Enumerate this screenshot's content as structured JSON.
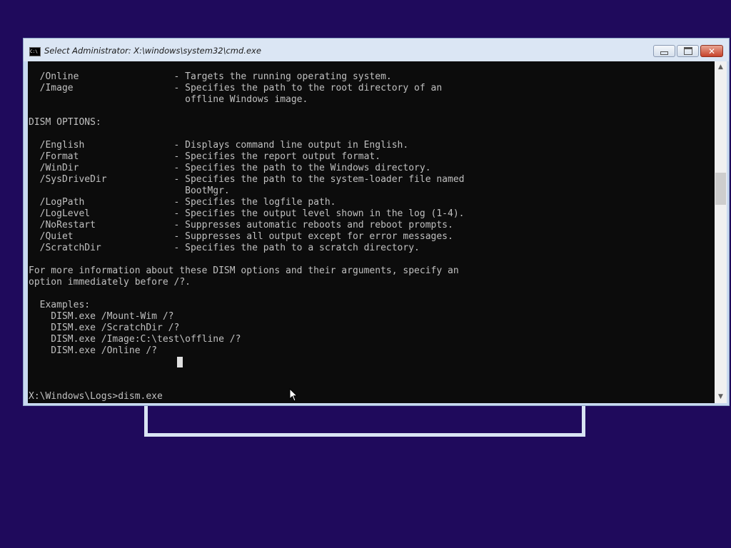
{
  "window": {
    "title": "Select Administrator: X:\\windows\\system32\\cmd.exe",
    "icon": "cmd-icon",
    "icon_text": "C:\\",
    "minimize_glyph": "",
    "maximize_glyph": "",
    "close_glyph": "✕"
  },
  "console": {
    "lines": [
      "  /Online                 - Targets the running operating system.",
      "  /Image                  - Specifies the path to the root directory of an",
      "                            offline Windows image.",
      "",
      "DISM OPTIONS:",
      "",
      "  /English                - Displays command line output in English.",
      "  /Format                 - Specifies the report output format.",
      "  /WinDir                 - Specifies the path to the Windows directory.",
      "  /SysDriveDir            - Specifies the path to the system-loader file named",
      "                            BootMgr.",
      "  /LogPath                - Specifies the logfile path.",
      "  /LogLevel               - Specifies the output level shown in the log (1-4).",
      "  /NoRestart              - Suppresses automatic reboots and reboot prompts.",
      "  /Quiet                  - Suppresses all output except for error messages.",
      "  /ScratchDir             - Specifies the path to a scratch directory.",
      "",
      "For more information about these DISM options and their arguments, specify an",
      "option immediately before /?.",
      "",
      "  Examples:",
      "    DISM.exe /Mount-Wim /?",
      "    DISM.exe /ScratchDir /?",
      "    DISM.exe /Image:C:\\test\\offline /?",
      "    DISM.exe /Online /?",
      "",
      "",
      "",
      "X:\\Windows\\Logs>dism.exe"
    ],
    "text_color": "#c0c0c0",
    "background_color": "#0c0c0c"
  },
  "scrollbar": {
    "up_icon": "▲",
    "down_icon": "▼"
  },
  "colors": {
    "desktop": "#1f0a5c",
    "close_button": "#c7432b"
  }
}
